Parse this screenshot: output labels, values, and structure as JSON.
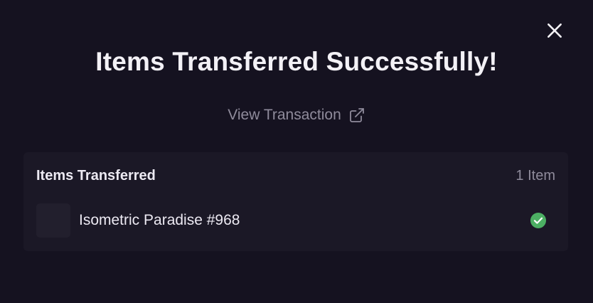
{
  "modal": {
    "title": "Items Transferred Successfully!",
    "close_icon": "close-icon",
    "view_transaction_label": "View Transaction",
    "external_link_icon": "external-link-icon"
  },
  "transferred": {
    "title": "Items Transferred",
    "count_label": "1 Item",
    "items": [
      {
        "name": "Isometric Paradise #968",
        "status_icon": "check-circle-icon",
        "status_color": "#4caf63"
      }
    ]
  },
  "colors": {
    "background": "#151220",
    "card": "#1b1826",
    "muted_text": "#8f8b9b",
    "success": "#4caf63"
  }
}
